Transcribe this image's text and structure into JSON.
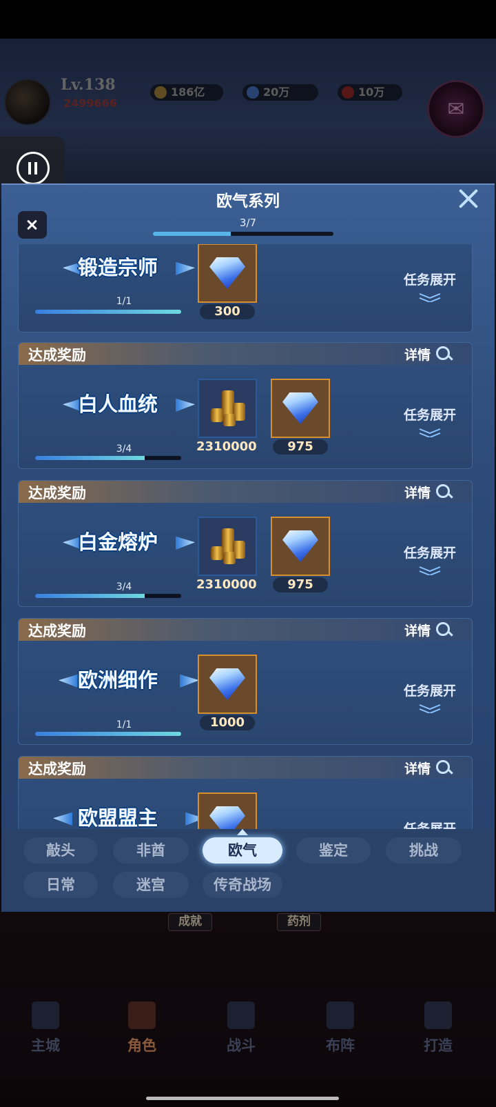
{
  "hud": {
    "level": "Lv.138",
    "power": "2499666",
    "gold": "186亿",
    "diamonds": "20万",
    "rubies": "10万"
  },
  "panel": {
    "title": "欧气系列",
    "progress_text": "3/7",
    "progress_fraction": 0.43
  },
  "cards": [
    {
      "title": "锻造宗师",
      "progress_text": "1/1",
      "progress_fraction": 1.0,
      "rewards": [
        {
          "type": "diamond",
          "amount": "300"
        }
      ],
      "expand_label": "任务展开"
    },
    {
      "header": "达成奖励",
      "detail_label": "详情",
      "title": "白人血统",
      "progress_text": "3/4",
      "progress_fraction": 0.75,
      "rewards": [
        {
          "type": "gold",
          "amount": "2310000"
        },
        {
          "type": "diamond",
          "amount": "975"
        }
      ],
      "expand_label": "任务展开"
    },
    {
      "header": "达成奖励",
      "detail_label": "详情",
      "title": "白金熔炉",
      "progress_text": "3/4",
      "progress_fraction": 0.75,
      "rewards": [
        {
          "type": "gold",
          "amount": "2310000"
        },
        {
          "type": "diamond",
          "amount": "975"
        }
      ],
      "expand_label": "任务展开"
    },
    {
      "header": "达成奖励",
      "detail_label": "详情",
      "title": "欧洲细作",
      "progress_text": "1/1",
      "progress_fraction": 1.0,
      "rewards": [
        {
          "type": "diamond",
          "amount": "1000"
        }
      ],
      "expand_label": "任务展开"
    },
    {
      "header": "达成奖励",
      "detail_label": "详情",
      "title": "欧盟盟主",
      "rewards": [
        {
          "type": "diamond",
          "amount": ""
        }
      ],
      "expand_label": "任务展开"
    }
  ],
  "tabs": {
    "row1": [
      "敲头",
      "非酋",
      "欧气",
      "鉴定",
      "挑战"
    ],
    "row2": [
      "日常",
      "迷宫",
      "传奇战场"
    ],
    "active": "欧气"
  },
  "sub_badges": [
    "成就",
    "药剂"
  ],
  "bottom_nav": [
    "主城",
    "角色",
    "战斗",
    "布阵",
    "打造"
  ],
  "bottom_nav_active": "角色"
}
